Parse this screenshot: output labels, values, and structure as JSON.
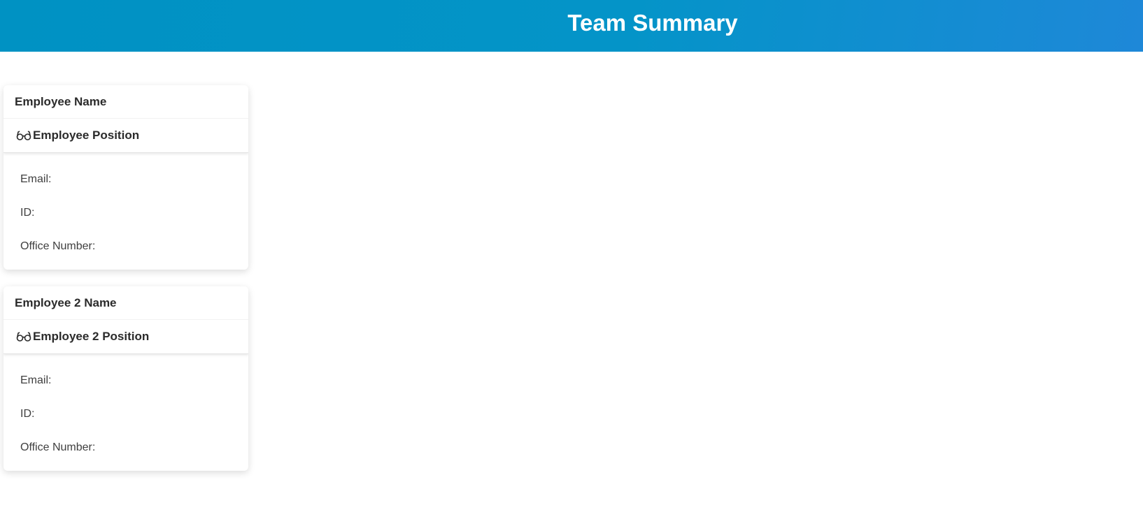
{
  "header": {
    "title": "Team Summary"
  },
  "employees": [
    {
      "name": "Employee Name",
      "position": "Employee Position",
      "role_icon": "glasses-icon",
      "email_label": "Email:",
      "id_label": "ID:",
      "office_label": "Office Number:"
    },
    {
      "name": "Employee 2 Name",
      "position": "Employee 2 Position",
      "role_icon": "glasses-icon",
      "email_label": "Email:",
      "id_label": "ID:",
      "office_label": "Office Number:"
    }
  ],
  "colors": {
    "banner_start": "#0092c3",
    "banner_end": "#1e88d8",
    "title_text": "#ffffff",
    "card_text": "#2b2b2b"
  }
}
